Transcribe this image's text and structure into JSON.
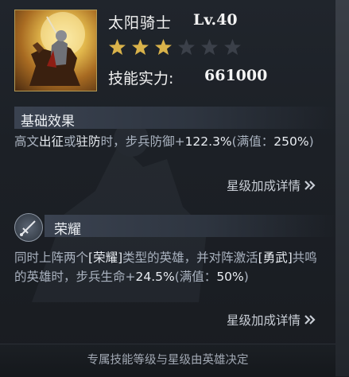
{
  "hero": {
    "name": "太阳骑士",
    "level": "Lv.40",
    "stars_filled": 3,
    "stars_total": 6,
    "power_label": "技能实力:",
    "power_value": "661000"
  },
  "base_effect": {
    "title": "基础效果",
    "desc": [
      {
        "t": "高文",
        "hl": false
      },
      {
        "t": "出征",
        "hl": true
      },
      {
        "t": "或",
        "hl": false
      },
      {
        "t": "驻防",
        "hl": true
      },
      {
        "t": "时，步兵防御+",
        "hl": false
      },
      {
        "t": "122.3%",
        "hl": true
      },
      {
        "t": "(满值：",
        "hl": false
      },
      {
        "t": "250%",
        "hl": true
      },
      {
        "t": ")",
        "hl": false
      }
    ],
    "link": "星级加成详情"
  },
  "glory": {
    "title": "荣耀",
    "desc": [
      {
        "t": "同时上阵两个",
        "hl": false
      },
      {
        "t": "[荣耀]",
        "hl": true
      },
      {
        "t": "类型的英雄，并对阵激活",
        "hl": false
      },
      {
        "t": "[勇武]",
        "hl": true
      },
      {
        "t": "共鸣的英雄时，步兵生命+",
        "hl": false
      },
      {
        "t": "24.5%",
        "hl": true
      },
      {
        "t": "(满值：",
        "hl": false
      },
      {
        "t": "50%",
        "hl": true
      },
      {
        "t": ")",
        "hl": false
      }
    ],
    "link": "星级加成详情"
  },
  "footer": "专属技能等级与星级由英雄决定",
  "colors": {
    "star_filled": "#d9b24a",
    "star_empty": "#3b4049"
  },
  "icons": {
    "star": "star-icon",
    "chevron": "double-chevron-right-icon",
    "glory": "sword-emblem-icon"
  }
}
